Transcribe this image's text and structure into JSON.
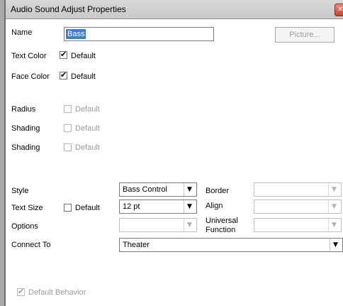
{
  "window": {
    "title": "Audio Sound Adjust Properties"
  },
  "name": {
    "label": "Name",
    "value": "Bass"
  },
  "picture_button": "Picture...",
  "text_color": {
    "label": "Text Color",
    "default_label": "Default"
  },
  "face_color": {
    "label": "Face Color",
    "default_label": "Default"
  },
  "radius": {
    "label": "Radius",
    "default_label": "Default"
  },
  "shading1": {
    "label": "Shading",
    "default_label": "Default"
  },
  "shading2": {
    "label": "Shading",
    "default_label": "Default"
  },
  "style": {
    "label": "Style",
    "value": "Bass Control"
  },
  "border": {
    "label": "Border",
    "value": ""
  },
  "text_size": {
    "label": "Text Size",
    "default_label": "Default",
    "value": "12 pt"
  },
  "align": {
    "label": "Align",
    "value": ""
  },
  "options": {
    "label": "Options",
    "value": ""
  },
  "universal_function": {
    "label_line1": "Universal",
    "label_line2": "Function",
    "value": ""
  },
  "connect_to": {
    "label": "Connect To",
    "value": "Theater"
  },
  "default_behavior": {
    "label": "Default Behavior"
  },
  "icons": {
    "check": "✔",
    "arrow": "▼",
    "close": "✕"
  }
}
